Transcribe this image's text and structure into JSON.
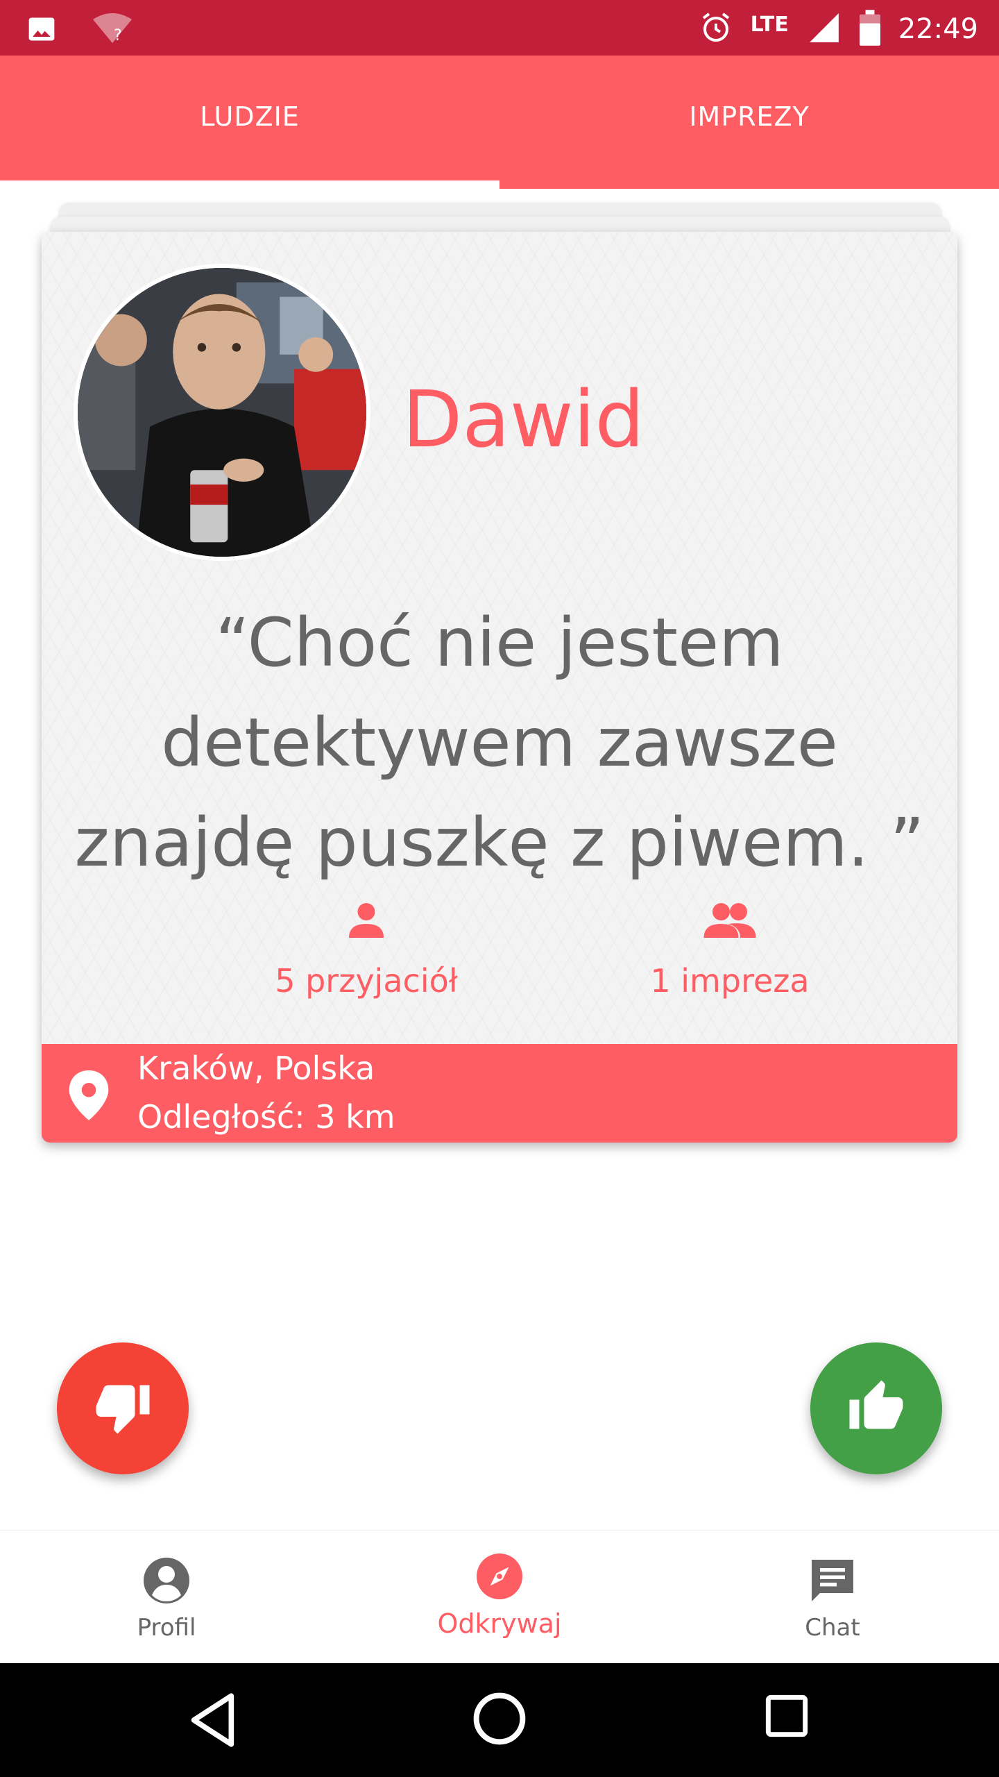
{
  "status_bar": {
    "time": "22:49",
    "network": "LTE",
    "icons": [
      "image-icon",
      "wifi-unknown-icon",
      "alarm-icon",
      "signal-icon",
      "battery-icon"
    ]
  },
  "tabs": [
    {
      "label": "LUDZIE",
      "selected": true
    },
    {
      "label": "IMPREZY",
      "selected": false
    }
  ],
  "profile_card": {
    "name": "Dawid",
    "quote": "“Choć nie jestem detektywem zawsze znajdę puszkę z piwem. ”",
    "friends": "5 przyjaciół",
    "parties": "1 impreza",
    "location": "Kraków, Polska",
    "distance": "Odległość: 3 km"
  },
  "actions": {
    "dislike_icon": "thumbs-down-icon",
    "like_icon": "thumbs-up-icon"
  },
  "bottom_nav": [
    {
      "label": "Profil",
      "icon": "account-circle-icon",
      "active": false
    },
    {
      "label": "Odkrywaj",
      "icon": "compass-icon",
      "active": true
    },
    {
      "label": "Chat",
      "icon": "chat-icon",
      "active": false
    }
  ],
  "colors": {
    "status_bar": "#c2203a",
    "accent": "#fe5d63",
    "dislike": "#f44336",
    "like": "#43a047",
    "text_gray": "#666666"
  }
}
